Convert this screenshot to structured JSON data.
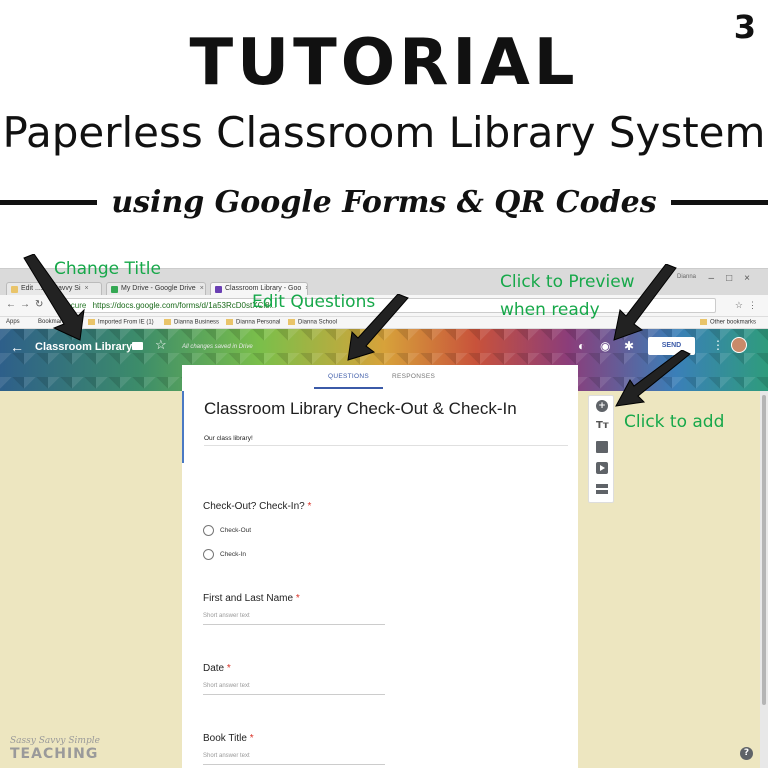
{
  "header": {
    "page_number": "3",
    "title": "TUTORIAL",
    "subtitle": "Paperless Classroom Library System",
    "tagline": "using Google Forms & QR Codes"
  },
  "browser": {
    "tabs": [
      {
        "label": "Edit ...ssy Savvy Si",
        "icon_color": "#e9c46a"
      },
      {
        "label": "My Drive - Google Drive",
        "icon_color": "#34a853"
      },
      {
        "label": "Classroom Library - Goo",
        "icon_color": "#6a3fb3"
      }
    ],
    "user_name": "Dianna",
    "secure_label": "Secure",
    "url": "https://docs.google.com/forms/d/1a53RcD0stXCi8...",
    "bookmarks": [
      "Apps",
      "Bookmarks",
      "Imported From IE (1)",
      "Dianna Business",
      "Dianna Personal",
      "Dianna School"
    ],
    "other_bookmarks": "Other bookmarks"
  },
  "forms": {
    "doc_title": "Classroom Library",
    "saved_status": "All changes saved in Drive",
    "send_label": "SEND",
    "tab_questions": "QUESTIONS",
    "tab_responses": "RESPONSES",
    "form_title": "Classroom Library Check-Out & Check-In",
    "form_description": "Our class library!",
    "questions": [
      {
        "label": "Check-Out? Check-In?",
        "required_mark": "*",
        "options": [
          "Check-Out",
          "Check-In"
        ]
      },
      {
        "label": "First and Last Name",
        "required_mark": "*",
        "placeholder": "Short answer text"
      },
      {
        "label": "Date",
        "required_mark": "*",
        "placeholder": "Short answer text"
      },
      {
        "label": "Book Title",
        "required_mark": "*",
        "placeholder": "Short answer text"
      }
    ],
    "toolbar_icons": [
      "add-question-icon",
      "title-text-icon",
      "image-icon",
      "video-icon",
      "section-icon"
    ],
    "accent_color": "#3b5aa8",
    "canvas_color": "#ede6c0"
  },
  "annotations": {
    "change_title": "Change Title",
    "edit_questions": "Edit Questions",
    "click_preview_line1": "Click to Preview",
    "click_preview_line2": "when ready",
    "click_to_add": "Click to add",
    "color": "#17a84a"
  },
  "watermark": {
    "line1": "Sassy Savvy Simple",
    "line2": "TEACHING"
  }
}
